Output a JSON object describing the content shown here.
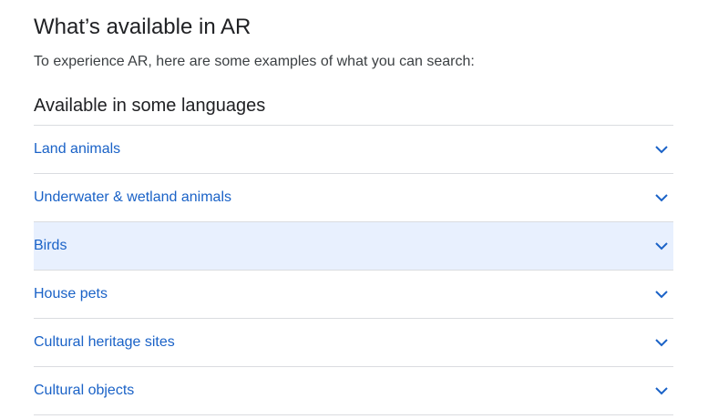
{
  "page": {
    "title": "What’s available in AR",
    "subtitle": "To experience AR, here are some examples of what you can search:",
    "section_heading": "Available in some languages"
  },
  "accordion": {
    "items": [
      {
        "label": "Land animals",
        "icon": "chevron-down-icon"
      },
      {
        "label": "Underwater & wetland animals",
        "icon": "chevron-down-icon"
      },
      {
        "label": "Birds",
        "icon": "chevron-down-icon",
        "highlighted": true
      },
      {
        "label": "House pets",
        "icon": "chevron-down-icon"
      },
      {
        "label": "Cultural heritage sites",
        "icon": "chevron-down-icon"
      },
      {
        "label": "Cultural objects",
        "icon": "chevron-down-icon"
      }
    ]
  },
  "colors": {
    "link": "#1a62c7",
    "highlight_background": "#e8f0fe",
    "divider": "#dadce0"
  }
}
